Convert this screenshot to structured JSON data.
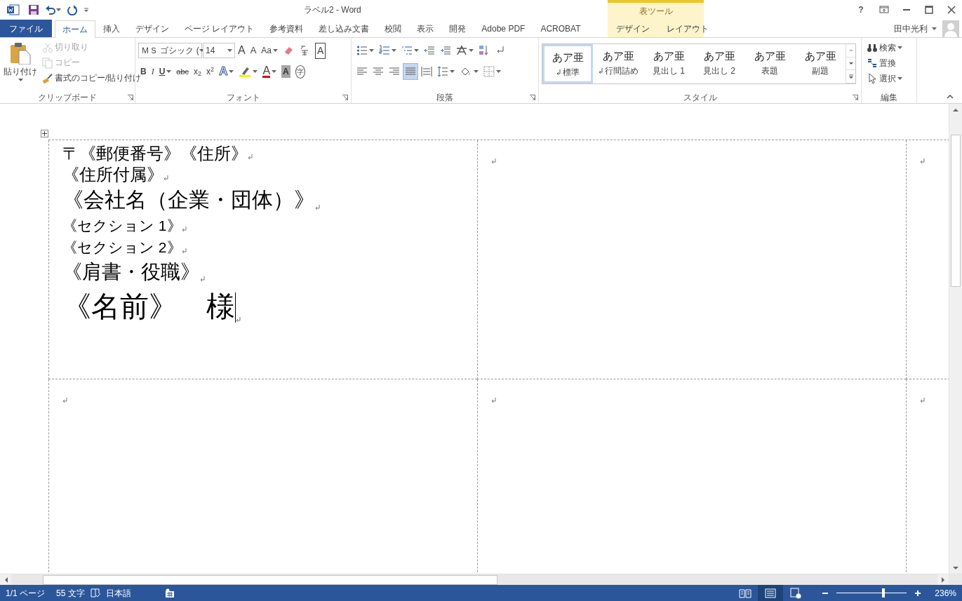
{
  "title_bar": {
    "title": "ラベル2 - Word",
    "help": "?"
  },
  "contextual_group": {
    "label": "表ツール"
  },
  "tabs": [
    {
      "label": "ファイル",
      "kind": "file",
      "selected": false
    },
    {
      "label": "ホーム",
      "kind": "normal",
      "selected": true
    },
    {
      "label": "挿入",
      "kind": "normal",
      "selected": false
    },
    {
      "label": "デザイン",
      "kind": "normal",
      "selected": false
    },
    {
      "label": "ページ レイアウト",
      "kind": "normal",
      "selected": false
    },
    {
      "label": "参考資料",
      "kind": "normal",
      "selected": false
    },
    {
      "label": "差し込み文書",
      "kind": "normal",
      "selected": false
    },
    {
      "label": "校閲",
      "kind": "normal",
      "selected": false
    },
    {
      "label": "表示",
      "kind": "normal",
      "selected": false
    },
    {
      "label": "開発",
      "kind": "normal",
      "selected": false
    },
    {
      "label": "Adobe PDF",
      "kind": "normal",
      "selected": false
    },
    {
      "label": "ACROBAT",
      "kind": "normal",
      "selected": false
    },
    {
      "label": "デザイン",
      "kind": "context",
      "selected": false
    },
    {
      "label": "レイアウト",
      "kind": "context",
      "selected": false
    }
  ],
  "user": {
    "name": "田中光利"
  },
  "ribbon": {
    "clipboard": {
      "label": "クリップボード",
      "paste": "貼り付け",
      "buttons": [
        {
          "kind": "cut",
          "label": "切り取り",
          "disabled": true
        },
        {
          "kind": "copy",
          "label": "コピー",
          "disabled": true
        },
        {
          "kind": "format-painter",
          "label": "書式のコピー/貼り付け",
          "disabled": false
        }
      ]
    },
    "font": {
      "label": "フォント",
      "font_name": "ＭＳ ゴシック (",
      "font_size": "14",
      "row1": [
        {
          "kind": "grow",
          "label": "A"
        },
        {
          "kind": "shrink",
          "label": "A"
        },
        {
          "kind": "case",
          "label": "Aa",
          "caret": true
        },
        {
          "kind": "clear"
        },
        {
          "kind": "phonetic"
        },
        {
          "kind": "char-border",
          "label": "A"
        }
      ],
      "row2": [
        {
          "kind": "bold",
          "label": "B"
        },
        {
          "kind": "italic",
          "label": "I"
        },
        {
          "kind": "underline",
          "label": "U",
          "caret": true
        },
        {
          "kind": "strike",
          "label": "abc"
        },
        {
          "kind": "subscript",
          "label": "x$_{2}$"
        },
        {
          "kind": "superscript",
          "label": "x$^{2}$"
        },
        {
          "kind": "effects",
          "label": "A",
          "caret": true
        },
        {
          "kind": "highlight",
          "caret": true
        },
        {
          "kind": "font-color",
          "label": "A",
          "caret": true
        },
        {
          "kind": "char-shading",
          "label": "A"
        },
        {
          "kind": "enclose",
          "label": "字"
        }
      ]
    },
    "paragraph": {
      "label": "段落",
      "row1": [
        {
          "kind": "bullets",
          "caret": true
        },
        {
          "kind": "numbering",
          "caret": true
        },
        {
          "kind": "multilevel",
          "caret": true
        },
        {
          "kind": "outdent"
        },
        {
          "kind": "indent"
        },
        {
          "kind": "asian-layout",
          "caret": true
        },
        {
          "kind": "sort"
        },
        {
          "kind": "show-marks"
        }
      ],
      "row2": [
        {
          "kind": "align-left",
          "selected": false
        },
        {
          "kind": "align-center",
          "selected": false
        },
        {
          "kind": "align-right",
          "selected": false
        },
        {
          "kind": "justify",
          "selected": true
        },
        {
          "kind": "distribute",
          "selected": false
        },
        {
          "kind": "line-spacing",
          "caret": true
        },
        {
          "kind": "fill",
          "caret": true
        },
        {
          "kind": "borders",
          "caret": true
        }
      ]
    },
    "styles": {
      "label": "スタイル",
      "items": [
        {
          "preview": "あア亜",
          "name": "標準",
          "paragraph_mark": true,
          "selected": true
        },
        {
          "preview": "あア亜",
          "name": "行間詰め",
          "paragraph_mark": true,
          "selected": false
        },
        {
          "preview": "あア亜",
          "name": "見出し 1",
          "paragraph_mark": false,
          "selected": false
        },
        {
          "preview": "あア亜",
          "name": "見出し 2",
          "paragraph_mark": false,
          "selected": false
        },
        {
          "preview": "あア亜",
          "name": "表題",
          "paragraph_mark": false,
          "selected": false
        },
        {
          "preview": "あア亜",
          "name": "副題",
          "paragraph_mark": false,
          "selected": false
        }
      ]
    },
    "editing": {
      "label": "編集",
      "buttons": [
        {
          "kind": "find",
          "label": "検索",
          "caret": true
        },
        {
          "kind": "replace",
          "label": "置換"
        },
        {
          "kind": "select",
          "label": "選択",
          "caret": true
        }
      ]
    }
  },
  "document": {
    "rows": [
      [
        {
          "lines": [
            {
              "text": "〒《郵便番号》《住所》",
              "kind": "address"
            },
            {
              "text": "《住所付属》",
              "kind": "address"
            },
            {
              "text": "《会社名（企業・団体）》",
              "kind": "company"
            },
            {
              "text": "《セクション 1》",
              "kind": "section"
            },
            {
              "text": "《セクション 2》",
              "kind": "section"
            },
            {
              "text": "《肩書・役職》",
              "kind": "position"
            },
            {
              "text": "《名前》　様",
              "kind": "name",
              "cursor": true
            }
          ]
        },
        {},
        {}
      ],
      [
        {},
        {},
        {}
      ]
    ]
  },
  "status_bar": {
    "page": "1/1 ページ",
    "word_count": "55 文字",
    "language": "日本語",
    "views": [
      {
        "kind": "read",
        "selected": false
      },
      {
        "kind": "print",
        "selected": true
      },
      {
        "kind": "web",
        "selected": false
      }
    ],
    "zoom_slider": {
      "level": 0.67
    },
    "zoom": "236%"
  }
}
